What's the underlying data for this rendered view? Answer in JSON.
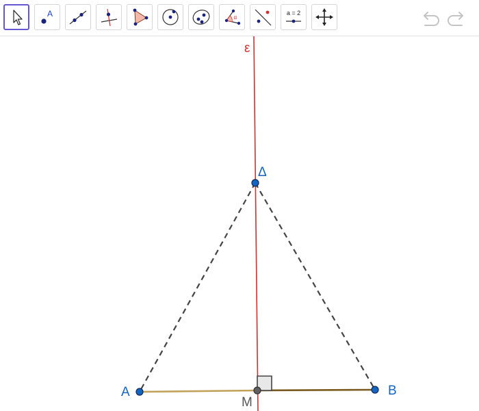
{
  "toolbar": {
    "tools": [
      {
        "name": "move-tool",
        "icon": "arrow-cursor-icon",
        "selected": true
      },
      {
        "name": "point-tool",
        "icon": "point-icon",
        "label": "A"
      },
      {
        "name": "line-tool",
        "icon": "line-through-two-points-icon"
      },
      {
        "name": "perpendicular-line-tool",
        "icon": "perpendicular-line-icon"
      },
      {
        "name": "polygon-tool",
        "icon": "polygon-icon"
      },
      {
        "name": "circle-center-point-tool",
        "icon": "circle-with-center-icon"
      },
      {
        "name": "ellipse-tool",
        "icon": "conic-ellipse-icon"
      },
      {
        "name": "angle-tool",
        "icon": "angle-icon",
        "label": "α"
      },
      {
        "name": "reflect-about-line-tool",
        "icon": "reflect-icon"
      },
      {
        "name": "slider-tool",
        "icon": "slider-icon",
        "label": "a = 2"
      },
      {
        "name": "move-graphics-view-tool",
        "icon": "move-view-icon"
      }
    ],
    "undo_icon": "undo-icon",
    "redo_icon": "redo-icon"
  },
  "colors": {
    "selected_border": "#6557d2",
    "point_fill": "#1565c0",
    "label_blue": "#1565c0",
    "line_red": "#d32f2f",
    "segment_AM": "#c2a25a",
    "segment_MB": "#7a5a1e",
    "dashed": "#444444",
    "point_M": "#606060",
    "label_M": "#555555"
  },
  "construction": {
    "line_label": "ε",
    "points": {
      "A": {
        "label": "A"
      },
      "B": {
        "label": "B"
      },
      "M": {
        "label": "M"
      },
      "D": {
        "label": "Δ"
      }
    }
  }
}
